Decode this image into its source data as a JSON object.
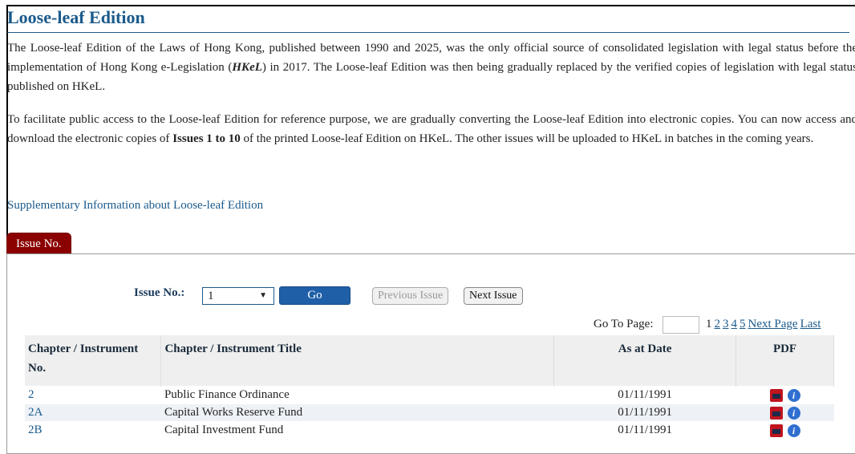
{
  "page": {
    "title": "Loose-leaf Edition",
    "paragraph1": [
      "The Loose-leaf Edition of the Laws of Hong Kong, published between 1990 and 2025, was the only official source of consolidated legislation with legal status before the implementation of Hong Kong e-Legislation (",
      "HKeL",
      ") in 2017. The Loose-leaf Edition was then being gradually replaced by the verified copies of legislation with legal status published on HKeL."
    ],
    "paragraph2": [
      "To facilitate public access to the Loose-leaf Edition for reference purpose, we are gradually converting the Loose-leaf Edition into electronic copies. You can now access and download the electronic copies of ",
      "Issues 1 to 10",
      " of the printed Loose-leaf Edition on HKeL. The other issues will be uploaded to HKeL in batches in the coming years."
    ],
    "supplementary_link": "Supplementary Information about Loose-leaf Edition"
  },
  "tab": {
    "label": "Issue No."
  },
  "issue": {
    "label": "Issue No.:",
    "selected": "1",
    "go_label": "Go",
    "prev_label": "Previous Issue",
    "next_label": "Next Issue"
  },
  "pager": {
    "goto_label": "Go To Page:",
    "current": "1",
    "pages": [
      "2",
      "3",
      "4",
      "5"
    ],
    "next_label": "Next Page",
    "last_label": "Last"
  },
  "table": {
    "headers": [
      "Chapter / Instrument No.",
      "Chapter / Instrument Title",
      "As at Date",
      "PDF"
    ],
    "rows": [
      {
        "no": "2",
        "title": "Public Finance Ordinance",
        "date": "01/11/1991"
      },
      {
        "no": "2A",
        "title": "Capital Works Reserve Fund",
        "date": "01/11/1991"
      },
      {
        "no": "2B",
        "title": "Capital Investment Fund",
        "date": "01/11/1991"
      }
    ]
  },
  "icons": {
    "pdf": "pdf-file-icon",
    "info": "info-icon"
  },
  "colors": {
    "title": "#1a5a8c",
    "tab": "#8b0000",
    "go_button": "#1f5fa8"
  }
}
